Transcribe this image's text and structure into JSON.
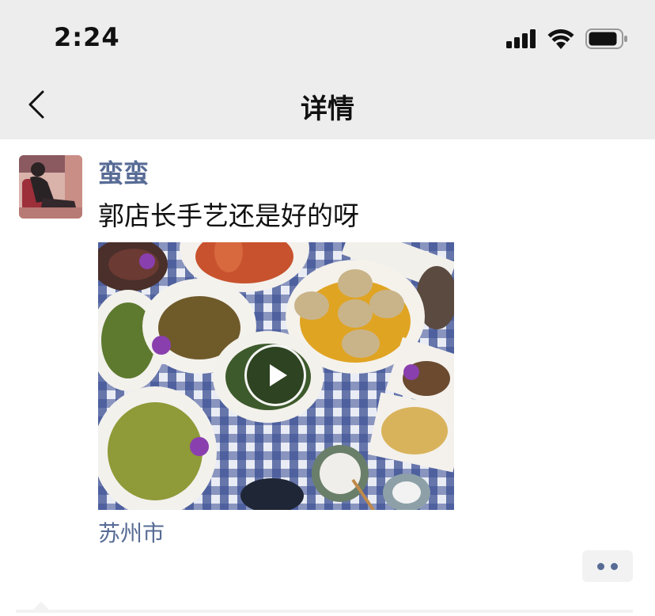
{
  "status_bar": {
    "time": "2:24",
    "icons": [
      "signal-icon",
      "wifi-icon",
      "battery-icon"
    ]
  },
  "nav": {
    "back_icon": "chevron-left-icon",
    "title": "详情"
  },
  "post": {
    "username": "蛮蛮",
    "text": "郭店长手艺还是好的呀",
    "media": {
      "type": "video",
      "play_icon": "play-icon"
    },
    "location": "苏州市",
    "more_icon": "more-dots-icon"
  },
  "colors": {
    "bar_bg": "#ededed",
    "link": "#576b95",
    "text": "#111111"
  }
}
